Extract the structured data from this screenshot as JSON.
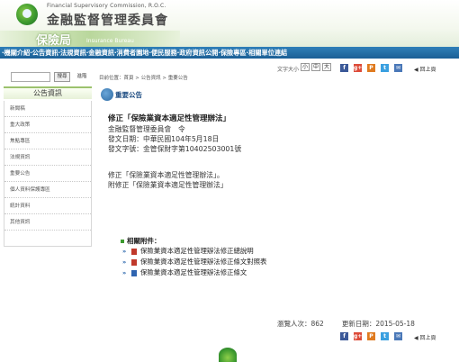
{
  "header": {
    "org_en": "Financial Supervisory Commission, R.O.C.",
    "org_zh": "金融監督管理委員會",
    "bureau_zh": "保險局",
    "bureau_en": "Insurance Bureau"
  },
  "nav": {
    "text": "‧機關介紹‧公告資訊‧法規資訊‧金融資訊‧消費者園地‧便民服務‧政府資訊公開‧保險專區‧相關單位連結"
  },
  "sidebar": {
    "search_placeholder": "",
    "search_button": "搜尋",
    "advanced_button": "進階",
    "title": "公告資訊",
    "items": [
      {
        "label": "新聞稿"
      },
      {
        "label": "重大政策"
      },
      {
        "label": "焦點專區"
      },
      {
        "label": "法規資訊"
      },
      {
        "label": "重要公告"
      },
      {
        "label": "個人資料保護專區"
      },
      {
        "label": "統計資料"
      },
      {
        "label": "其他資訊"
      }
    ]
  },
  "main": {
    "breadcrumb": "目前位置：首頁 > 公告資訊 > 重要公告",
    "fontsize_label": "文字大小",
    "fontsize_options": [
      "小",
      "中",
      "大"
    ],
    "back_top": "回上頁",
    "section_title": "重要公告",
    "doc": {
      "title": "修正「保險業資本適足性管理辦法」",
      "issuer": "金融監督管理委員會　令",
      "date": "發文日期：中華民國104年5月18日",
      "number": "發文字號：金管保財字第10402503001號",
      "body1": "修正「保險業資本適足性管理辦法」。",
      "body2": "附修正「保險業資本適足性管理辦法」"
    },
    "attachments": {
      "heading": "相關附件：",
      "items": [
        {
          "label": "保險業資本適足性管理辦法修正總說明",
          "type": "pdf"
        },
        {
          "label": "保險業資本適足性管理辦法修正條文對照表",
          "type": "pdf"
        },
        {
          "label": "保險業資本適足性管理辦法修正條文",
          "type": "doc"
        }
      ]
    },
    "stats": {
      "views": "瀏覽人次：862",
      "updated": "更新日期：2015-05-18"
    }
  },
  "social": [
    "f",
    "g+",
    "P",
    "t",
    "✉"
  ]
}
